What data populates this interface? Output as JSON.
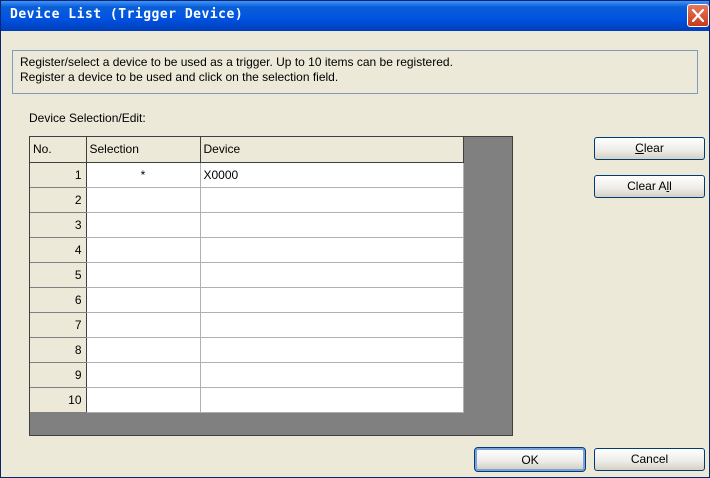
{
  "window": {
    "title": "Device List (Trigger Device)"
  },
  "info": {
    "line1": "Register/select a device to be used as a trigger. Up to 10 items can be registered.",
    "line2": "Register a device to be used and click on the selection field."
  },
  "section_label": "Device Selection/Edit:",
  "table": {
    "headers": [
      "No.",
      "Selection",
      "Device"
    ],
    "rows": [
      {
        "no": "1",
        "selection": "*",
        "device": "X0000"
      },
      {
        "no": "2",
        "selection": "",
        "device": ""
      },
      {
        "no": "3",
        "selection": "",
        "device": ""
      },
      {
        "no": "4",
        "selection": "",
        "device": ""
      },
      {
        "no": "5",
        "selection": "",
        "device": ""
      },
      {
        "no": "6",
        "selection": "",
        "device": ""
      },
      {
        "no": "7",
        "selection": "",
        "device": ""
      },
      {
        "no": "8",
        "selection": "",
        "device": ""
      },
      {
        "no": "9",
        "selection": "",
        "device": ""
      },
      {
        "no": "10",
        "selection": "",
        "device": ""
      }
    ]
  },
  "buttons": {
    "clear": {
      "before": "",
      "accel": "C",
      "after": "lear"
    },
    "clear_all": {
      "before": "Clear A",
      "accel": "l",
      "after": "l"
    },
    "ok": "OK",
    "cancel": "Cancel"
  },
  "icons": {
    "close": "close-icon"
  },
  "colors": {
    "titlebar": "#0054E3",
    "face": "#ECE9D8",
    "close": "#C9391B"
  }
}
